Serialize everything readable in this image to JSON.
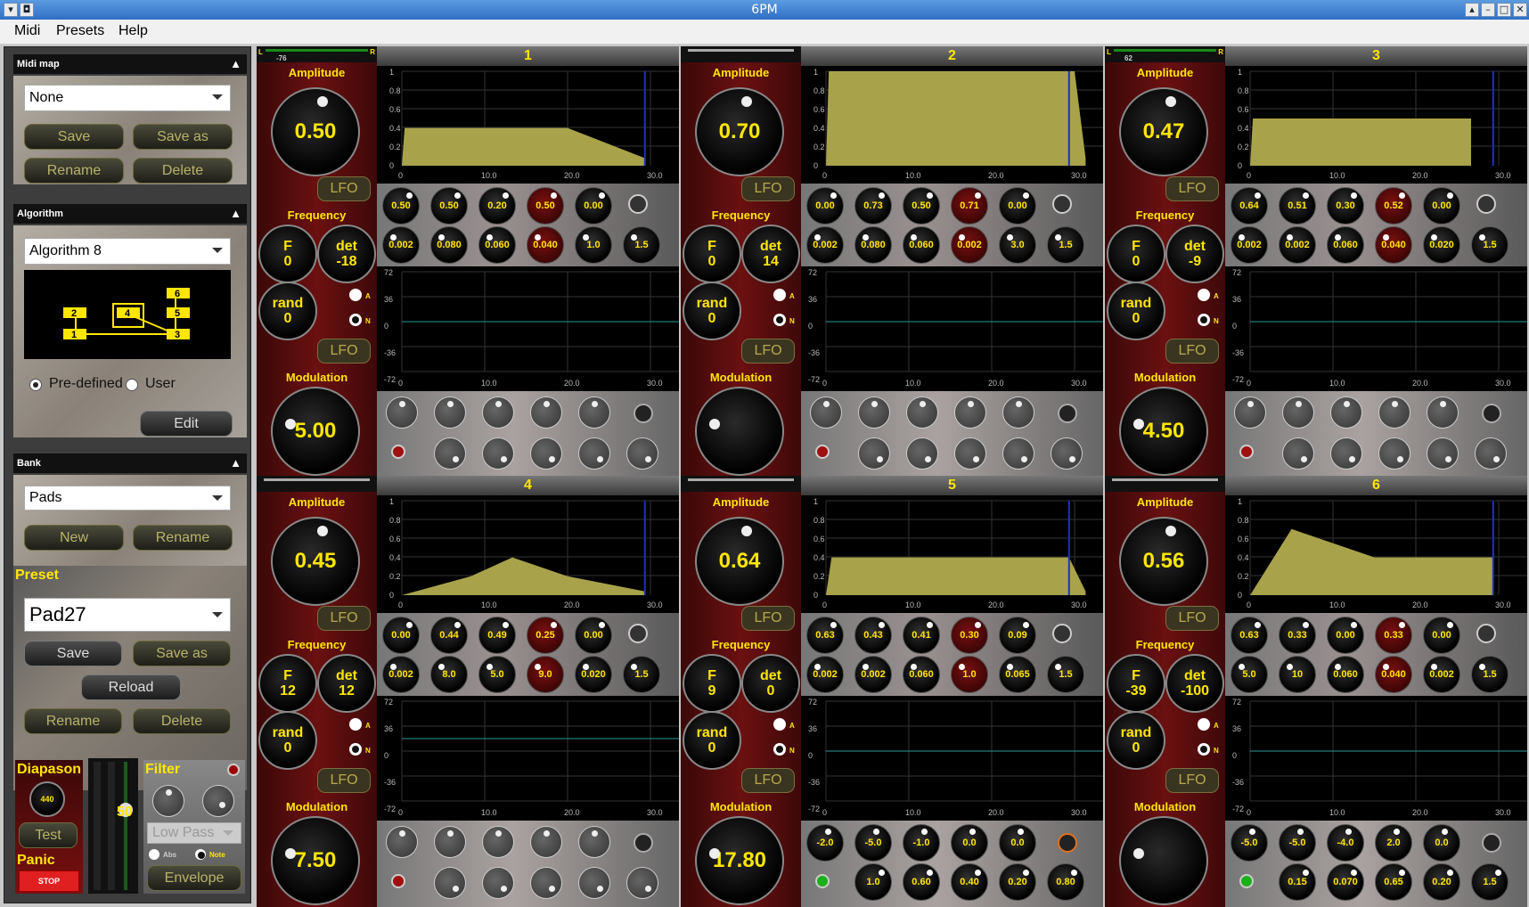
{
  "window": {
    "title": "6PM"
  },
  "menu": [
    "Midi",
    "Presets",
    "Help"
  ],
  "left": {
    "midi_map": {
      "header": "Midi map",
      "selected": "None",
      "buttons": [
        "Save",
        "Save as",
        "Rename",
        "Delete"
      ]
    },
    "algorithm": {
      "header": "Algorithm",
      "selected": "Algorithm 8",
      "options": [
        "Pre-defined",
        "User"
      ],
      "selected_option": "Pre-defined",
      "edit": "Edit",
      "nodes": [
        "2",
        "1",
        "4",
        "6",
        "5",
        "3"
      ]
    },
    "bank": {
      "header": "Bank",
      "selected": "Pads",
      "buttons": [
        "New",
        "Rename"
      ]
    },
    "preset": {
      "header": "Preset",
      "selected": "Pad27",
      "buttons": [
        "Save",
        "Save as",
        "Reload",
        "Rename",
        "Delete"
      ]
    },
    "bottom": {
      "diapason": "Diapason",
      "diapason_value": "440",
      "test": "Test",
      "panic": "Panic",
      "stop": "STOP",
      "level": "50",
      "filter": "Filter",
      "filter_type": "Low Pass",
      "abs": "Abs",
      "note": "Note",
      "envelope": "Envelope"
    }
  },
  "labels": {
    "amplitude": "Amplitude",
    "frequency": "Frequency",
    "modulation": "Modulation",
    "lfo": "LFO",
    "f": "F",
    "det": "det",
    "rand": "rand",
    "a": "A",
    "n": "N"
  },
  "env_axis": {
    "y": [
      "1",
      "0.8",
      "0.6",
      "0.4",
      "0.2",
      "0"
    ],
    "x": [
      "0",
      "10.0",
      "20.0",
      "30.0"
    ]
  },
  "lfo_axis": {
    "y": [
      "72",
      "36",
      "0",
      "-36",
      "-72"
    ],
    "x": [
      "0",
      "10.0",
      "20.0",
      "30.0"
    ]
  },
  "operators": [
    {
      "title": "1",
      "pan": "-76",
      "pan_l": "L",
      "pan_r": "R",
      "amplitude": "0.50",
      "f": "0",
      "det": "-18",
      "rand": "0",
      "modulation": "5.00",
      "row1": [
        "0.50",
        "0.50",
        "0.20",
        "0.50",
        "0.00"
      ],
      "row2": [
        "0.002",
        "0.080",
        "0.060",
        "0.040",
        "1.0",
        "1.5"
      ]
    },
    {
      "title": "2",
      "pan": "",
      "pan_l": "",
      "pan_r": "",
      "amplitude": "0.70",
      "f": "0",
      "det": "14",
      "rand": "0",
      "modulation": "",
      "row1": [
        "0.00",
        "0.73",
        "0.50",
        "0.71",
        "0.00"
      ],
      "row2": [
        "0.002",
        "0.080",
        "0.060",
        "0.002",
        "3.0",
        "1.5"
      ]
    },
    {
      "title": "3",
      "pan": "62",
      "pan_l": "L",
      "pan_r": "R",
      "amplitude": "0.47",
      "f": "0",
      "det": "-9",
      "rand": "0",
      "modulation": "4.50",
      "row1": [
        "0.64",
        "0.51",
        "0.30",
        "0.52",
        "0.00"
      ],
      "row2": [
        "0.002",
        "0.002",
        "0.060",
        "0.040",
        "0.020",
        "1.5"
      ]
    },
    {
      "title": "4",
      "pan": "",
      "pan_l": "",
      "pan_r": "",
      "amplitude": "0.45",
      "f": "12",
      "det": "12",
      "rand": "0",
      "modulation": "7.50",
      "row1": [
        "0.00",
        "0.44",
        "0.49",
        "0.25",
        "0.00"
      ],
      "row2": [
        "0.002",
        "8.0",
        "5.0",
        "9.0",
        "0.020",
        "1.5"
      ]
    },
    {
      "title": "5",
      "pan": "",
      "pan_l": "",
      "pan_r": "",
      "amplitude": "0.64",
      "f": "9",
      "det": "0",
      "rand": "0",
      "modulation": "17.80",
      "row1": [
        "0.63",
        "0.43",
        "0.41",
        "0.30",
        "0.09"
      ],
      "row2": [
        "0.002",
        "0.002",
        "0.060",
        "1.0",
        "0.065",
        "1.5"
      ],
      "mod1": [
        "-2.0",
        "-5.0",
        "-1.0",
        "0.0",
        "0.0"
      ],
      "mod2": [
        "1.0",
        "0.60",
        "0.40",
        "0.20",
        "0.80"
      ]
    },
    {
      "title": "6",
      "pan": "",
      "pan_l": "",
      "pan_r": "",
      "amplitude": "0.56",
      "f": "-39",
      "det": "-100",
      "rand": "0",
      "modulation": "",
      "row1": [
        "0.63",
        "0.33",
        "0.00",
        "0.33",
        "0.00"
      ],
      "row2": [
        "5.0",
        "10",
        "0.060",
        "0.040",
        "0.002",
        "1.5"
      ],
      "mod1": [
        "-5.0",
        "-5.0",
        "-4.0",
        "2.0",
        "0.0"
      ],
      "mod2": [
        "0.15",
        "0.070",
        "0.65",
        "0.20",
        "1.5"
      ]
    }
  ],
  "colors": {
    "accent": "#ffe600",
    "env_fill": "#a8a24a",
    "panel_red": "#6b1010",
    "window_blue": "#2f6fc4"
  }
}
